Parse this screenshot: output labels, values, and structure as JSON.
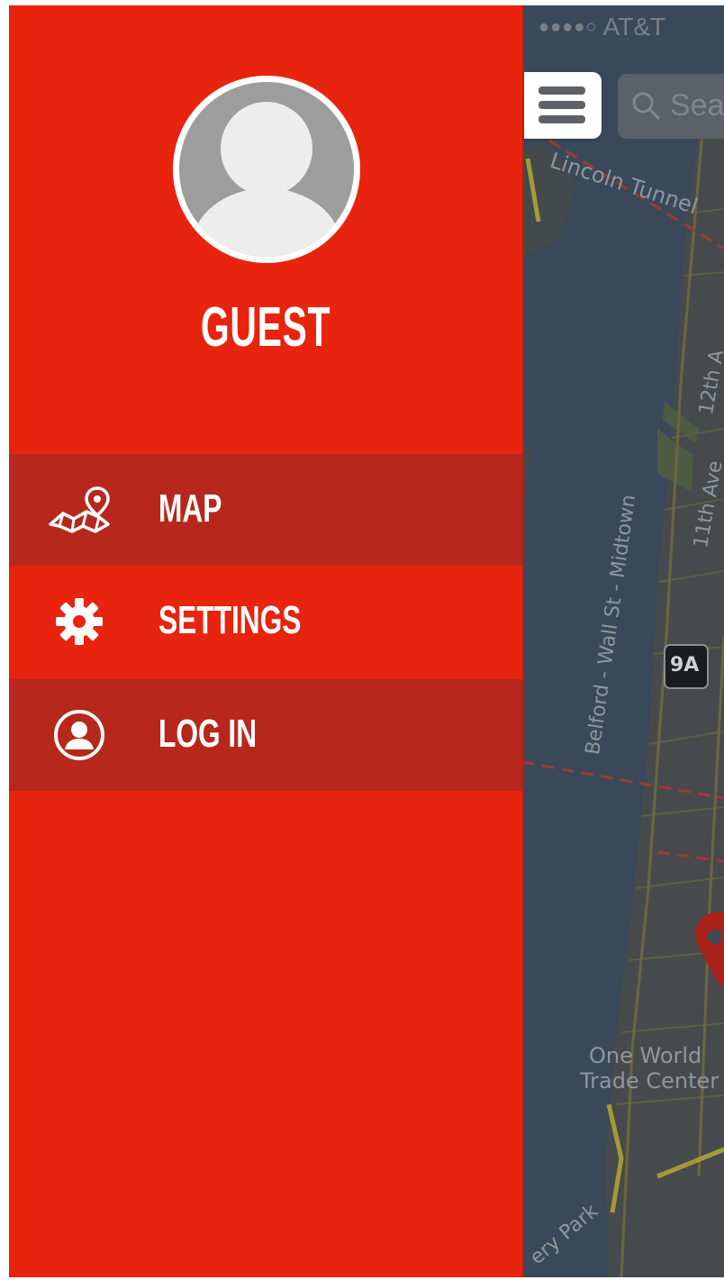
{
  "status_bar": {
    "signal_dots": "●●●●○",
    "carrier": "AT&T"
  },
  "map": {
    "search_placeholder": "Sea",
    "labels": {
      "lincoln_tunnel": "Lincoln Tunnel",
      "midtown": "Belford - Wall St - Midtown",
      "ave_12th": "12th A",
      "ave_11th": "11th Ave",
      "route_9a": "9A",
      "world_trade_1": "One World",
      "world_trade_2": "Trade Center",
      "park": "ery Park"
    }
  },
  "drawer": {
    "user_name": "GUEST",
    "items": [
      {
        "label": "MAP",
        "icon": "map-pin-icon"
      },
      {
        "label": "SETTINGS",
        "icon": "gear-icon"
      },
      {
        "label": "LOG IN",
        "icon": "user-circle-icon"
      }
    ]
  },
  "colors": {
    "drawer": "#e8230e",
    "drawer_active": "#b7271b",
    "map_overlay": "#3f4a55"
  }
}
